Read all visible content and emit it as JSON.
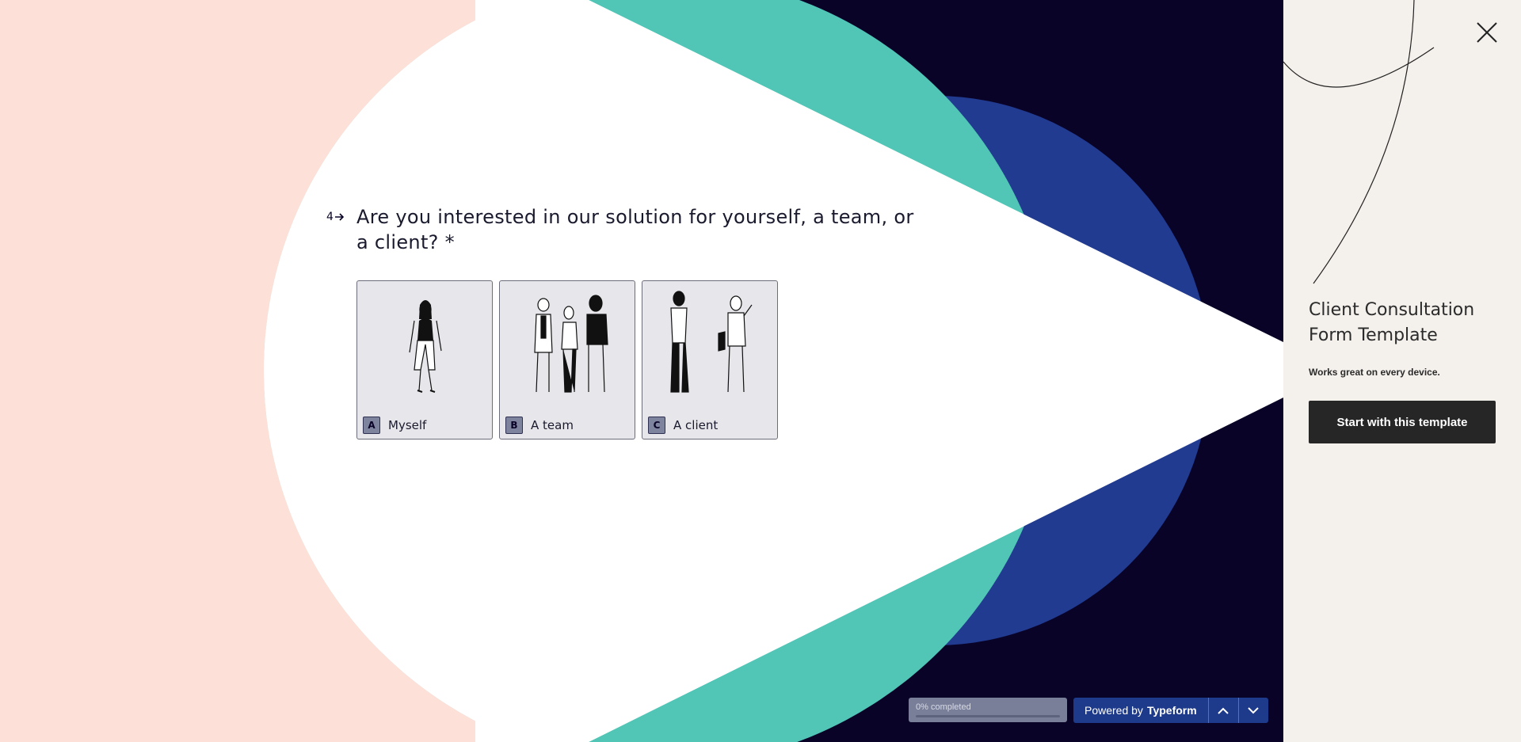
{
  "question": {
    "number": "4",
    "text": "Are you interested in our solution for yourself, a team, or a client? *",
    "choices": [
      {
        "key": "A",
        "label": "Myself",
        "icon": "single-person-illustration"
      },
      {
        "key": "B",
        "label": "A team",
        "icon": "group-of-people-illustration"
      },
      {
        "key": "C",
        "label": "A client",
        "icon": "two-people-talking-illustration"
      }
    ]
  },
  "footer": {
    "progress_text": "0% completed",
    "progress_value": 0,
    "powered_prefix": "Powered by",
    "powered_brand": "Typeform",
    "prev_icon": "chevron-up-icon",
    "next_icon": "chevron-down-icon"
  },
  "panel": {
    "title": "Client Consultation Form Template",
    "subtitle": "Works great on every device.",
    "cta_label": "Start with this template",
    "close_icon": "close-icon"
  },
  "colors": {
    "background_peach": "#fde0d8",
    "navy": "#0a0328",
    "teal": "#52c6b6",
    "blue": "#213b91",
    "white": "#ffffff",
    "panel_bg": "#f4f0eb",
    "cta_bg": "#262626"
  }
}
